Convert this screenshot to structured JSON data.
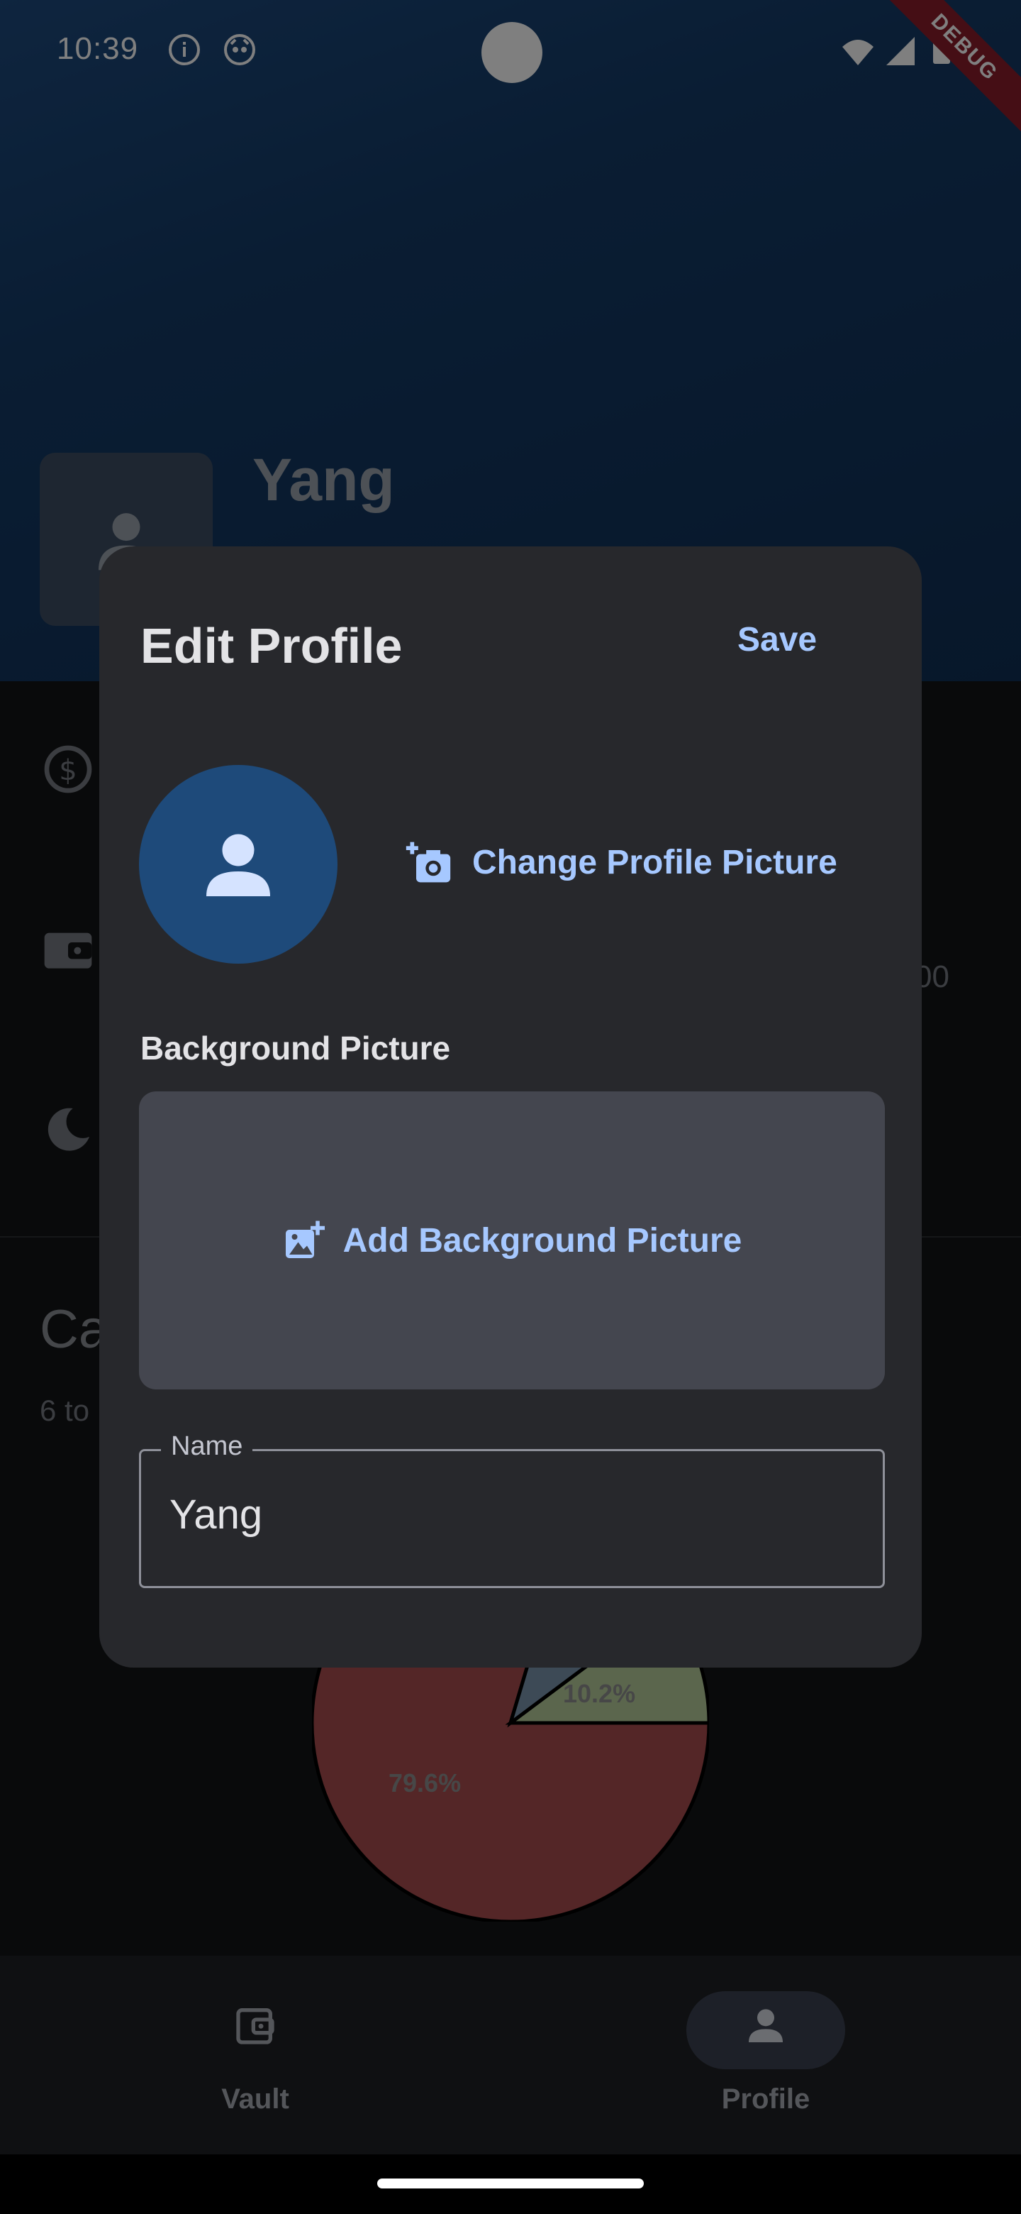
{
  "status": {
    "time": "10:39",
    "debug_label": "DEBUG"
  },
  "profile": {
    "name": "Yang"
  },
  "background": {
    "peek_value": "00",
    "section_title_peek": "Ca",
    "section_sub_peek": "6 to"
  },
  "chart_data": {
    "type": "pie",
    "labels": [
      "79.6%",
      "10.2%"
    ],
    "values": [
      79.6,
      10.2
    ],
    "colors": [
      "#a84d4f",
      "#b6cc9b",
      "#7a94ad"
    ]
  },
  "dialog": {
    "title": "Edit Profile",
    "save_label": "Save",
    "change_picture_label": "Change Profile Picture",
    "background_section_label": "Background Picture",
    "add_background_label": "Add Background Picture",
    "name_field": {
      "label": "Name",
      "value": "Yang"
    }
  },
  "bottom_nav": {
    "items": [
      {
        "label": "Vault",
        "icon": "wallet-icon"
      },
      {
        "label": "Profile",
        "icon": "person-icon",
        "selected": true
      }
    ]
  },
  "colors": {
    "accent": "#a6c8ff",
    "dialog_bg": "#27282c",
    "hero_blue": "#1d4a7e"
  }
}
